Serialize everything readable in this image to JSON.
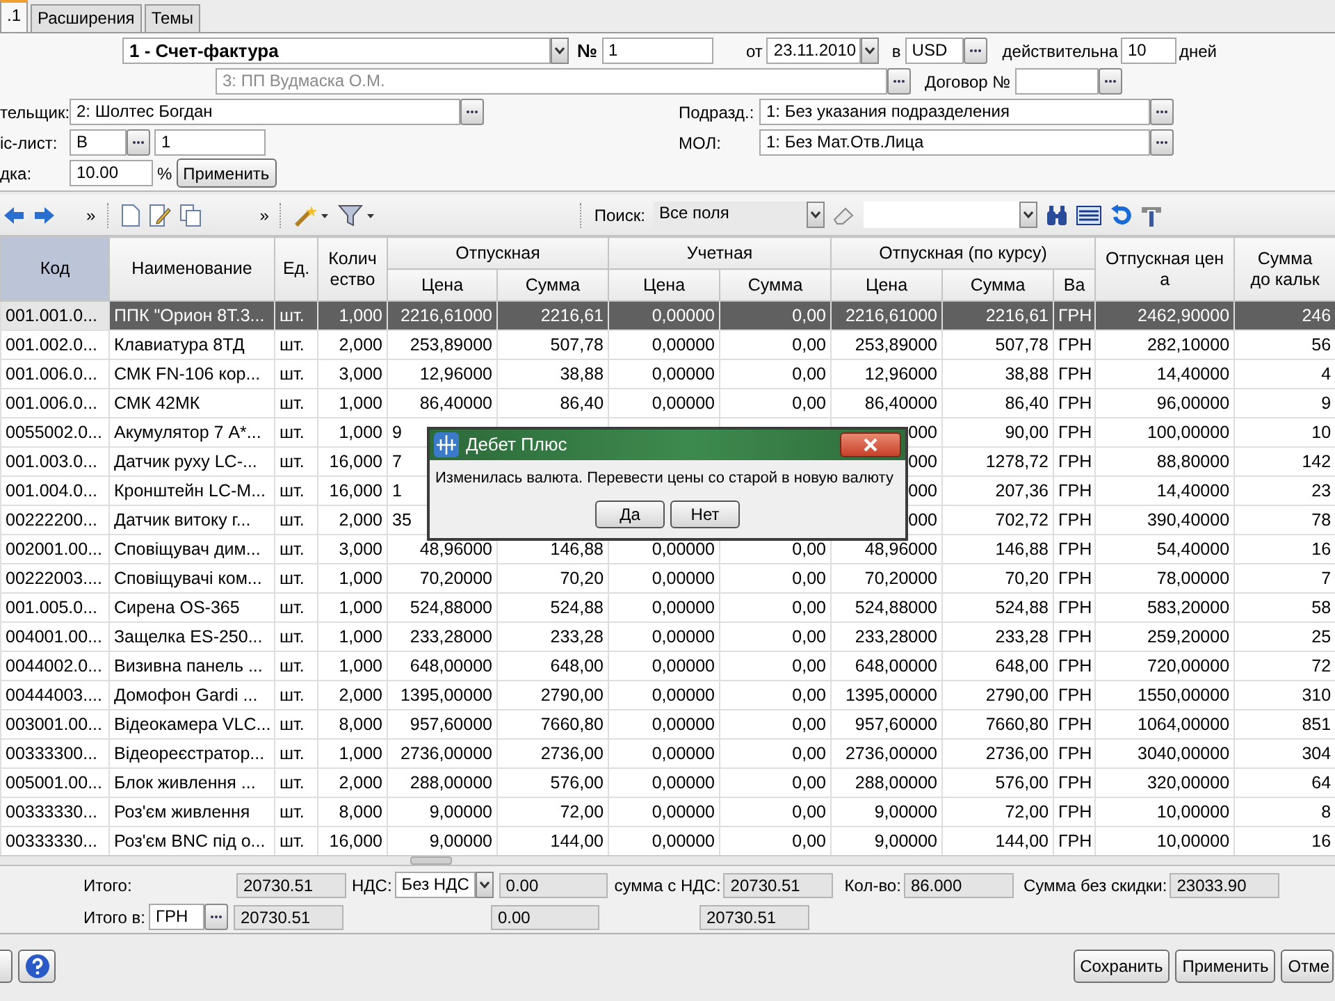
{
  "tabs": [
    {
      "label": ".1",
      "selected": true
    },
    {
      "label": "Расширения",
      "selected": false
    },
    {
      "label": "Темы",
      "selected": false
    }
  ],
  "document": {
    "type": "1 - Счет-фактура",
    "number_label": "№",
    "number": "1",
    "date_label": "от",
    "date": "23.11.2010",
    "currency_label": "в",
    "currency": "USD",
    "valid_label": "действительна",
    "valid_days": "10",
    "days_label": "дней"
  },
  "organization": {
    "value": "3: ПП Вудмаска О.М.",
    "disabled": true
  },
  "contract": {
    "label": "Договор №"
  },
  "payer": {
    "label": "тельщик:",
    "value": "2: Шолтес Богдан"
  },
  "subdivision": {
    "label": "Подразд.:",
    "value": "1: Без указания подразделения"
  },
  "price_list": {
    "label": "іс-лист:",
    "code": "В",
    "number": "1"
  },
  "mol": {
    "label": "МОЛ:",
    "value": "1: Без Мат.Отв.Лица"
  },
  "discount": {
    "label": "дка:",
    "value": "10.00",
    "unit": "%",
    "button": "Применить"
  },
  "toolbar": {
    "overflow_marks": [
      "»",
      "»"
    ],
    "search_label": "Поиск:",
    "search_scope": "Все поля"
  },
  "table": {
    "columns": [
      {
        "label": "Код",
        "sorted": true
      },
      {
        "label": "Наименование",
        "sorted": false
      },
      {
        "label": "Ед.",
        "sorted": false
      },
      {
        "label": "Колич\nество",
        "sorted": false
      },
      {
        "label": "Отпускная",
        "sorted": false,
        "colspan": 2,
        "children": [
          {
            "label": "Цена"
          },
          {
            "label": "Сумма"
          }
        ]
      },
      {
        "label": "Учетная",
        "sorted": false,
        "colspan": 2,
        "children": [
          {
            "label": "Цена"
          },
          {
            "label": "Сумма"
          }
        ]
      },
      {
        "label": "Отпускная (по курсу)",
        "sorted": false,
        "colspan": 3,
        "children": [
          {
            "label": "Цена"
          },
          {
            "label": "Сумма"
          },
          {
            "label": "Ва"
          }
        ]
      },
      {
        "label": "Отпускная цен\nа",
        "sorted": false
      },
      {
        "label": "Сумма\nдо кальк",
        "sorted": false
      }
    ],
    "rows": [
      {
        "selected": true,
        "covered": false,
        "cells": [
          "001.001.0...",
          "ППК \"Орион 8Т.3...",
          "шт.",
          "1,000",
          "2216,61000",
          "2216,61",
          "0,00000",
          "0,00",
          "2216,61000",
          "2216,61",
          "ГРН",
          "2462,90000",
          "246"
        ]
      },
      {
        "selected": false,
        "covered": false,
        "cells": [
          "001.002.0...",
          "Клавиатура 8ТД",
          "шт.",
          "2,000",
          "253,89000",
          "507,78",
          "0,00000",
          "0,00",
          "253,89000",
          "507,78",
          "ГРН",
          "282,10000",
          "56"
        ]
      },
      {
        "selected": false,
        "covered": false,
        "cells": [
          "001.006.0...",
          "СМК FN-106 кор...",
          "шт.",
          "3,000",
          "12,96000",
          "38,88",
          "0,00000",
          "0,00",
          "12,96000",
          "38,88",
          "ГРН",
          "14,40000",
          "4"
        ]
      },
      {
        "selected": false,
        "covered": false,
        "cells": [
          "001.006.0...",
          "СМК 42МК",
          "шт.",
          "1,000",
          "86,40000",
          "86,40",
          "0,00000",
          "0,00",
          "86,40000",
          "86,40",
          "ГРН",
          "96,00000",
          "9"
        ]
      },
      {
        "selected": false,
        "covered": true,
        "cells": [
          "0055002.0...",
          "Акумулятор 7 А*...",
          "шт.",
          "1,000",
          "9",
          null,
          null,
          null,
          "000",
          "90,00",
          "ГРН",
          "100,00000",
          "10"
        ]
      },
      {
        "selected": false,
        "covered": true,
        "cells": [
          "001.003.0...",
          "Датчик руху LC-...",
          "шт.",
          "16,000",
          "7",
          null,
          null,
          null,
          "000",
          "1278,72",
          "ГРН",
          "88,80000",
          "142"
        ]
      },
      {
        "selected": false,
        "covered": true,
        "cells": [
          "001.004.0...",
          "Кронштейн LC-M...",
          "шт.",
          "16,000",
          "1",
          null,
          null,
          null,
          "000",
          "207,36",
          "ГРН",
          "14,40000",
          "23"
        ]
      },
      {
        "selected": false,
        "covered": true,
        "cells": [
          "00222200...",
          "Датчик витоку г...",
          "шт.",
          "2,000",
          "35",
          null,
          null,
          null,
          "000",
          "702,72",
          "ГРН",
          "390,40000",
          "78"
        ]
      },
      {
        "selected": false,
        "covered": false,
        "cells": [
          "002001.00...",
          "Сповіщувач дим...",
          "шт.",
          "3,000",
          "48,96000",
          "146,88",
          "0,00000",
          "0,00",
          "48,96000",
          "146,88",
          "ГРН",
          "54,40000",
          "16"
        ]
      },
      {
        "selected": false,
        "covered": false,
        "cells": [
          "00222003....",
          "Сповіщувачі ком...",
          "шт.",
          "1,000",
          "70,20000",
          "70,20",
          "0,00000",
          "0,00",
          "70,20000",
          "70,20",
          "ГРН",
          "78,00000",
          "7"
        ]
      },
      {
        "selected": false,
        "covered": false,
        "cells": [
          "001.005.0...",
          "Сирена OS-365",
          "шт.",
          "1,000",
          "524,88000",
          "524,88",
          "0,00000",
          "0,00",
          "524,88000",
          "524,88",
          "ГРН",
          "583,20000",
          "58"
        ]
      },
      {
        "selected": false,
        "covered": false,
        "cells": [
          "004001.00...",
          "Защелка ES-250...",
          "шт.",
          "1,000",
          "233,28000",
          "233,28",
          "0,00000",
          "0,00",
          "233,28000",
          "233,28",
          "ГРН",
          "259,20000",
          "25"
        ]
      },
      {
        "selected": false,
        "covered": false,
        "cells": [
          "0044002.0...",
          "Визивна панель ...",
          "шт.",
          "1,000",
          "648,00000",
          "648,00",
          "0,00000",
          "0,00",
          "648,00000",
          "648,00",
          "ГРН",
          "720,00000",
          "72"
        ]
      },
      {
        "selected": false,
        "covered": false,
        "cells": [
          "00444003....",
          "Домофон Gardi ...",
          "шт.",
          "2,000",
          "1395,00000",
          "2790,00",
          "0,00000",
          "0,00",
          "1395,00000",
          "2790,00",
          "ГРН",
          "1550,00000",
          "310"
        ]
      },
      {
        "selected": false,
        "covered": false,
        "cells": [
          "003001.00...",
          "Відеокамера VLC...",
          "шт.",
          "8,000",
          "957,60000",
          "7660,80",
          "0,00000",
          "0,00",
          "957,60000",
          "7660,80",
          "ГРН",
          "1064,00000",
          "851"
        ]
      },
      {
        "selected": false,
        "covered": false,
        "cells": [
          "00333300...",
          "Відеореєстратор...",
          "шт.",
          "1,000",
          "2736,00000",
          "2736,00",
          "0,00000",
          "0,00",
          "2736,00000",
          "2736,00",
          "ГРН",
          "3040,00000",
          "304"
        ]
      },
      {
        "selected": false,
        "covered": false,
        "cells": [
          "005001.00...",
          "Блок живлення ...",
          "шт.",
          "2,000",
          "288,00000",
          "576,00",
          "0,00000",
          "0,00",
          "288,00000",
          "576,00",
          "ГРН",
          "320,00000",
          "64"
        ]
      },
      {
        "selected": false,
        "covered": false,
        "cells": [
          "00333330...",
          "Роз'єм живлення",
          "шт.",
          "8,000",
          "9,00000",
          "72,00",
          "0,00000",
          "0,00",
          "9,00000",
          "72,00",
          "ГРН",
          "10,00000",
          "8"
        ]
      },
      {
        "selected": false,
        "covered": false,
        "cells": [
          "00333330...",
          "Роз'єм BNC під о...",
          "шт.",
          "16,000",
          "9,00000",
          "144,00",
          "0,00000",
          "0,00",
          "9,00000",
          "144,00",
          "ГРН",
          "10,00000",
          "16"
        ]
      }
    ]
  },
  "totals": {
    "label": "Итого:",
    "total": "20730.51",
    "vat_label": "НДС:",
    "vat_mode": "Без НДС",
    "vat": "0.00",
    "with_vat_label": "сумма с НДС:",
    "with_vat": "20730.51",
    "qty_label": "Кол-во:",
    "qty": "86.000",
    "no_discount_label": "Сумма без скидки:",
    "no_discount": "23033.90"
  },
  "totals_in": {
    "label": "Итого в:",
    "currency": "ГРН",
    "total": "20730.51",
    "vat": "0.00",
    "with_vat": "20730.51"
  },
  "buttons": [
    "Сохранить",
    "Применить",
    "Отме"
  ],
  "dialog": {
    "title": "Дебет Плюс",
    "message": "Изменилась валюта. Перевести цены со старой в новую валюту",
    "buttons": [
      "Да",
      "Нет"
    ]
  }
}
